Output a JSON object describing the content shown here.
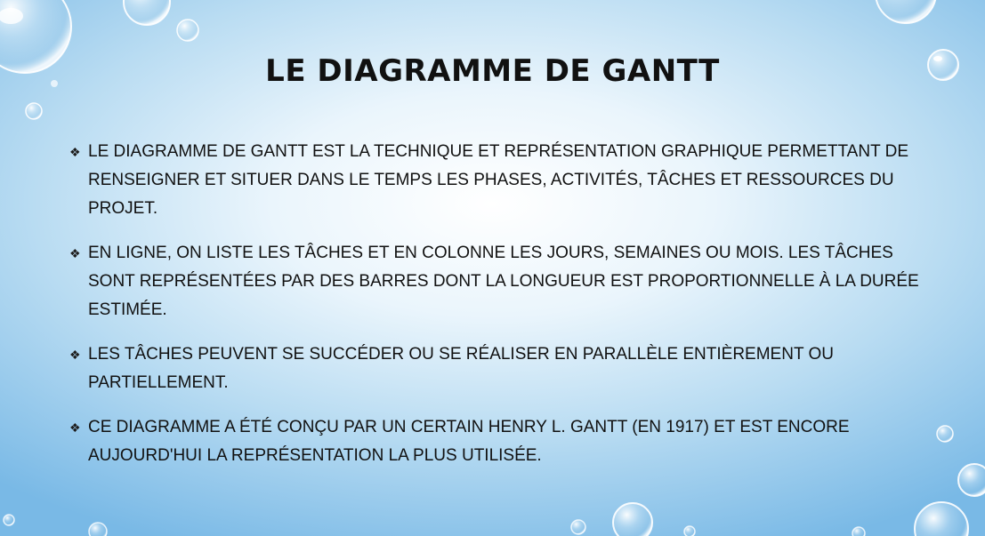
{
  "slide": {
    "title": "Le diagramme de Gantt",
    "bullet_icon": "diamond-bullet-icon",
    "bullets": [
      "Le diagramme de GANTT est la technique et représentation graphique permettant de renseigner et situer dans le temps les phases, activités, tâches et ressources du projet.",
      "En ligne, on liste les tâches et en colonne les jours, semaines ou mois. Les tâches sont représentées par des barres dont la longueur est proportionnelle à la durée estimée.",
      "Les tâches peuvent se succéder ou se réaliser en parallèle entièrement ou partiellement.",
      "Ce diagramme a été conçu par un certain Henry L. Gantt (en 1917) et est encore aujourd'hui la représentation la plus utilisée."
    ]
  },
  "colors": {
    "text": "#111111",
    "background_light": "#ffffff",
    "background_dark": "#79b9e6"
  }
}
